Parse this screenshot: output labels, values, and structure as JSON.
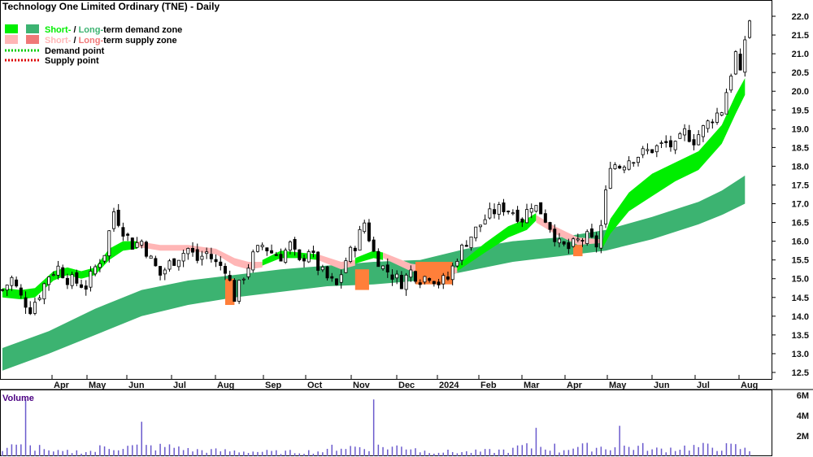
{
  "chart_data": {
    "type": "candlestick",
    "title": "Technology One Limited Ordinary (TNE) - Daily",
    "legend": {
      "placement": "top-left",
      "items": [
        {
          "short": "Short-",
          "sep": " / ",
          "long": "Long-",
          "rest": "term demand zone",
          "short_color": "#00ee00",
          "long_color": "#3cb371"
        },
        {
          "short": "Short-",
          "sep": " / ",
          "long": "Long-",
          "rest": "term supply zone",
          "short_color": "#ffb6b6",
          "long_color": "#f07878"
        },
        {
          "text": "Demand point",
          "color": "#00cc00"
        },
        {
          "text": "Supply point",
          "color": "#dd0000"
        }
      ]
    },
    "x_ticks": [
      "Apr",
      "May",
      "Jun",
      "Jul",
      "Aug",
      "Sep",
      "Oct",
      "Nov",
      "Dec",
      "2024",
      "Feb",
      "Mar",
      "Apr",
      "May",
      "Jun",
      "Jul",
      "Aug"
    ],
    "y_ticks": [
      "22.0",
      "21.5",
      "21.0",
      "20.5",
      "20.0",
      "19.5",
      "19.0",
      "18.5",
      "18.0",
      "17.5",
      "17.0",
      "16.5",
      "16.0",
      "15.5",
      "15.0",
      "14.5",
      "14.0",
      "13.5",
      "13.0",
      "12.5"
    ],
    "ylim": [
      12.2,
      22.2
    ],
    "volume": {
      "label": "Volume",
      "y_ticks": [
        "6M",
        "4M",
        "2M"
      ],
      "ylim": [
        0,
        6.5
      ]
    },
    "price_path": [
      [
        0,
        14.7
      ],
      [
        2,
        15.0
      ],
      [
        4,
        14.5
      ],
      [
        6,
        14.2
      ],
      [
        8,
        14.6
      ],
      [
        10,
        15.1
      ],
      [
        12,
        15.3
      ],
      [
        14,
        15.0
      ],
      [
        16,
        14.9
      ],
      [
        18,
        14.8
      ],
      [
        20,
        15.3
      ],
      [
        22,
        15.7
      ],
      [
        24,
        16.8
      ],
      [
        26,
        16.3
      ],
      [
        28,
        15.9
      ],
      [
        30,
        16.0
      ],
      [
        32,
        15.5
      ],
      [
        34,
        15.1
      ],
      [
        36,
        15.4
      ],
      [
        38,
        15.6
      ],
      [
        40,
        15.8
      ],
      [
        42,
        15.5
      ],
      [
        44,
        15.7
      ],
      [
        46,
        15.4
      ],
      [
        48,
        15.3
      ],
      [
        50,
        14.5
      ],
      [
        52,
        15.1
      ],
      [
        54,
        15.6
      ],
      [
        56,
        15.9
      ],
      [
        58,
        15.7
      ],
      [
        60,
        15.6
      ],
      [
        62,
        15.9
      ],
      [
        64,
        15.4
      ],
      [
        66,
        15.8
      ],
      [
        68,
        15.3
      ],
      [
        70,
        15.0
      ],
      [
        72,
        14.8
      ],
      [
        74,
        15.5
      ],
      [
        76,
        15.9
      ],
      [
        78,
        16.5
      ],
      [
        80,
        15.7
      ],
      [
        82,
        15.3
      ],
      [
        84,
        15.1
      ],
      [
        86,
        14.9
      ],
      [
        88,
        15.2
      ],
      [
        90,
        15.0
      ],
      [
        92,
        15.1
      ],
      [
        94,
        14.9
      ],
      [
        96,
        15.0
      ],
      [
        98,
        15.6
      ],
      [
        100,
        16.0
      ],
      [
        102,
        16.3
      ],
      [
        104,
        16.6
      ],
      [
        106,
        16.8
      ],
      [
        108,
        16.9
      ],
      [
        110,
        16.8
      ],
      [
        112,
        16.6
      ],
      [
        114,
        17.0
      ],
      [
        116,
        16.8
      ],
      [
        118,
        16.4
      ],
      [
        120,
        15.9
      ],
      [
        122,
        15.8
      ],
      [
        124,
        16.0
      ],
      [
        126,
        16.1
      ],
      [
        128,
        15.9
      ],
      [
        129,
        16.4
      ],
      [
        131,
        18.1
      ],
      [
        133,
        18.0
      ],
      [
        135,
        18.2
      ],
      [
        137,
        18.3
      ],
      [
        139,
        18.4
      ],
      [
        141,
        18.5
      ],
      [
        143,
        18.6
      ],
      [
        145,
        18.5
      ],
      [
        147,
        18.9
      ],
      [
        149,
        18.7
      ],
      [
        151,
        19.0
      ],
      [
        153,
        19.3
      ],
      [
        155,
        19.5
      ],
      [
        157,
        20.5
      ],
      [
        158,
        21.0
      ],
      [
        159,
        20.4
      ],
      [
        160,
        21.4
      ],
      [
        161,
        21.9
      ]
    ],
    "volume_path": [
      [
        0,
        0.5
      ],
      [
        5,
        5.6
      ],
      [
        10,
        0.4
      ],
      [
        20,
        0.5
      ],
      [
        30,
        3.4
      ],
      [
        40,
        0.6
      ],
      [
        50,
        0.5
      ],
      [
        60,
        0.4
      ],
      [
        70,
        0.5
      ],
      [
        80,
        5.6
      ],
      [
        90,
        0.5
      ],
      [
        100,
        0.4
      ],
      [
        110,
        0.6
      ],
      [
        115,
        2.8
      ],
      [
        120,
        0.5
      ],
      [
        133,
        3.0
      ],
      [
        140,
        0.6
      ],
      [
        150,
        1.0
      ],
      [
        155,
        1.4
      ],
      [
        161,
        0.5
      ]
    ],
    "long_zone": [
      [
        0,
        12.55,
        13.15
      ],
      [
        10,
        13.0,
        13.6
      ],
      [
        20,
        13.5,
        14.2
      ],
      [
        30,
        14.0,
        14.7
      ],
      [
        40,
        14.3,
        14.95
      ],
      [
        50,
        14.5,
        15.1
      ],
      [
        60,
        14.65,
        15.25
      ],
      [
        70,
        14.8,
        15.35
      ],
      [
        80,
        14.85,
        15.45
      ],
      [
        90,
        14.95,
        15.5
      ],
      [
        100,
        15.2,
        15.8
      ],
      [
        110,
        15.45,
        16.0
      ],
      [
        120,
        15.6,
        16.1
      ],
      [
        130,
        15.75,
        16.3
      ],
      [
        140,
        16.05,
        16.65
      ],
      [
        150,
        16.45,
        17.05
      ],
      [
        155,
        16.7,
        17.35
      ],
      [
        160,
        17.0,
        17.75
      ]
    ],
    "short_zones": [
      {
        "kind": "demand",
        "band": [
          [
            0,
            14.5,
            14.75
          ],
          [
            4,
            14.45,
            14.7
          ],
          [
            7,
            14.5,
            14.75
          ],
          [
            11,
            14.95,
            15.2
          ],
          [
            14,
            15.1,
            15.3
          ],
          [
            17,
            15.0,
            15.2
          ],
          [
            20,
            15.1,
            15.3
          ],
          [
            23,
            15.5,
            15.8
          ],
          [
            26,
            15.75,
            16.0
          ],
          [
            29,
            15.8,
            16.0
          ]
        ]
      },
      {
        "kind": "supply",
        "band": [
          [
            29,
            15.85,
            16.0
          ],
          [
            34,
            15.75,
            15.9
          ],
          [
            40,
            15.75,
            15.9
          ],
          [
            46,
            15.65,
            15.8
          ],
          [
            50,
            15.35,
            15.55
          ],
          [
            53,
            15.25,
            15.45
          ],
          [
            56,
            15.3,
            15.45
          ]
        ]
      },
      {
        "kind": "demand",
        "band": [
          [
            56,
            15.35,
            15.5
          ],
          [
            60,
            15.55,
            15.75
          ],
          [
            64,
            15.55,
            15.7
          ],
          [
            68,
            15.5,
            15.65
          ]
        ]
      },
      {
        "kind": "supply",
        "band": [
          [
            68,
            15.5,
            15.65
          ],
          [
            73,
            15.25,
            15.45
          ],
          [
            76,
            15.35,
            15.5
          ]
        ]
      },
      {
        "kind": "demand",
        "band": [
          [
            76,
            15.4,
            15.55
          ],
          [
            80,
            15.55,
            15.75
          ],
          [
            82,
            15.5,
            15.7
          ]
        ]
      },
      {
        "kind": "supply",
        "band": [
          [
            82,
            15.55,
            15.7
          ],
          [
            88,
            15.2,
            15.4
          ],
          [
            94,
            15.1,
            15.3
          ],
          [
            98,
            15.15,
            15.3
          ]
        ]
      },
      {
        "kind": "demand",
        "band": [
          [
            98,
            15.2,
            15.35
          ],
          [
            104,
            15.7,
            15.95
          ],
          [
            109,
            16.1,
            16.4
          ],
          [
            113,
            16.3,
            16.6
          ],
          [
            115,
            16.55,
            16.75
          ]
        ]
      },
      {
        "kind": "supply",
        "band": [
          [
            115,
            16.5,
            16.7
          ],
          [
            119,
            16.2,
            16.4
          ],
          [
            124,
            15.9,
            16.1
          ],
          [
            129,
            15.95,
            16.05
          ]
        ]
      },
      {
        "kind": "demand",
        "band": [
          [
            129,
            15.75,
            15.9
          ],
          [
            131,
            16.2,
            16.6
          ],
          [
            135,
            16.8,
            17.3
          ],
          [
            140,
            17.2,
            17.8
          ],
          [
            145,
            17.6,
            18.1
          ],
          [
            150,
            17.9,
            18.4
          ],
          [
            155,
            18.6,
            19.1
          ],
          [
            158,
            19.4,
            19.9
          ],
          [
            160,
            19.9,
            20.35
          ]
        ]
      }
    ],
    "overlap_zones": [
      [
        48,
        50,
        14.3,
        15.0
      ],
      [
        76,
        79,
        14.7,
        15.25
      ],
      [
        89,
        97,
        14.85,
        15.45
      ],
      [
        123,
        125,
        15.6,
        15.9
      ]
    ]
  }
}
